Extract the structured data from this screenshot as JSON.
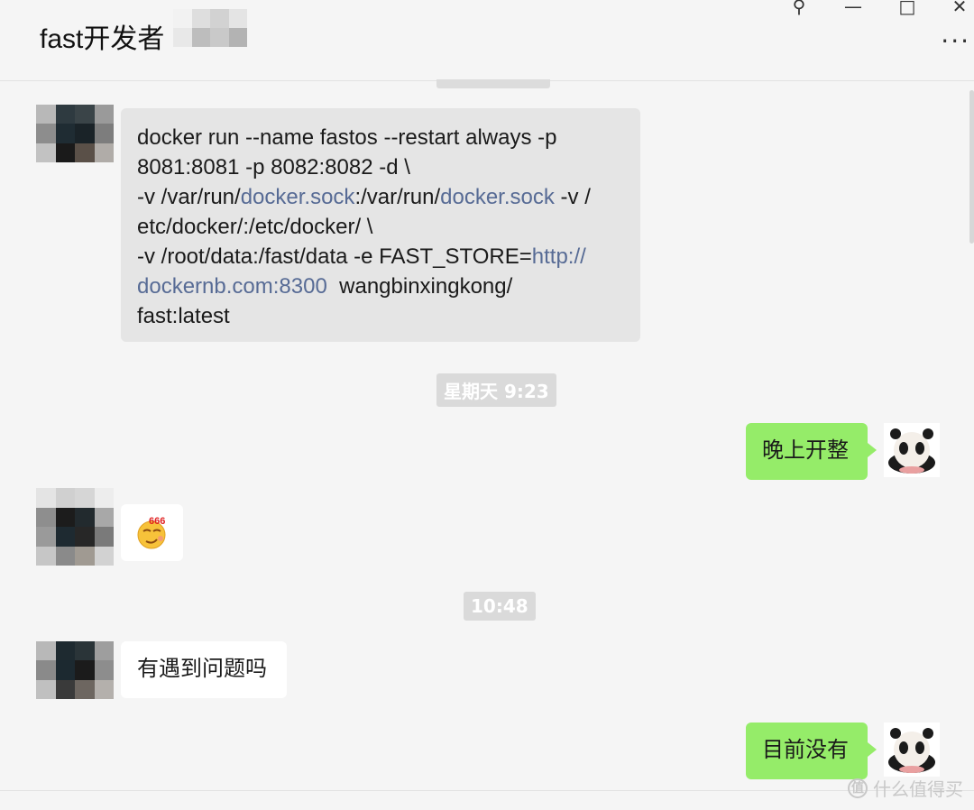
{
  "header": {
    "title": "fast开发者",
    "pin_glyph": "⚲",
    "minimize_glyph": "—",
    "maximize_glyph": "□",
    "close_glyph": "✕",
    "more_glyph": "···"
  },
  "messages": [
    {
      "type": "incoming",
      "segments": [
        {
          "text": "docker run --name fastos --restart always -p\n8081:8081 -p 8082:8082 -d \\\n-v /var/run/",
          "link": false
        },
        {
          "text": "docker.sock",
          "link": true
        },
        {
          "text": ":/var/run/",
          "link": false
        },
        {
          "text": "docker.sock",
          "link": true
        },
        {
          "text": " -v /\netc/docker/:/etc/docker/ \\\n-v /root/data:/fast/data -e FAST_STORE=",
          "link": false
        },
        {
          "text": "http://\ndockernb.com:8300",
          "link": true
        },
        {
          "text": "  wangbinxingkong/\nfast:latest",
          "link": false
        }
      ]
    }
  ],
  "timestamps": [
    "星期天 9:23",
    "10:48"
  ],
  "chat": {
    "out_1": "晚上开整",
    "in_emoji": "😏",
    "in_emoji_badge": "666",
    "in_2": "有遇到问题吗",
    "out_2": "目前没有"
  },
  "watermark": {
    "icon": "值",
    "text": "什么值得买"
  },
  "colors": {
    "bubble_out": "#95ec69",
    "bubble_in": "#ffffff",
    "link": "#576b95",
    "background": "#f5f5f5"
  }
}
